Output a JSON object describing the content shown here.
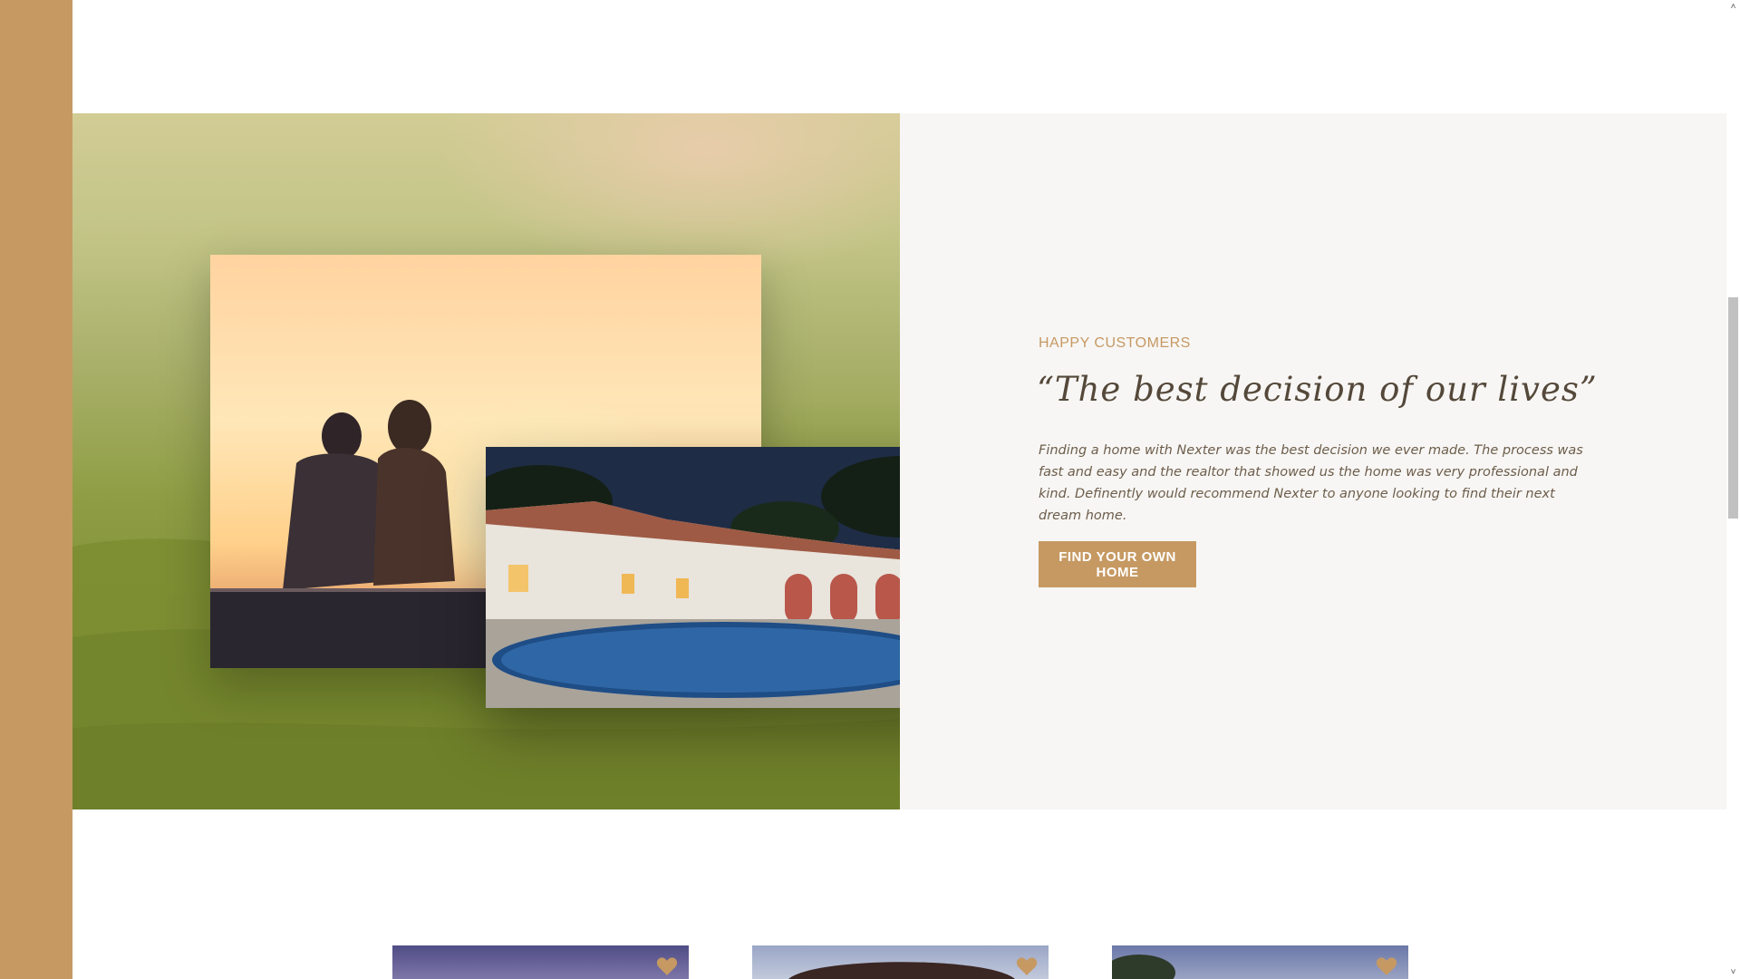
{
  "story": {
    "subheading": "HAPPY CUSTOMERS",
    "heading": "“The best decision of our lives”",
    "text": "Finding a home with Nexter was the best decision we ever made. The process was fast and easy and the realtor that showed us the home was very professional and kind. Definently would recommend Nexter to anyone looking to find their next dream home.",
    "button_label": "FIND YOUR OWN HOME"
  },
  "colors": {
    "primary": "#c69963",
    "heading": "#54483a",
    "text": "#6d5d4b",
    "background_light": "#f7f6f4"
  },
  "homes": {
    "icons": [
      "heart-icon",
      "heart-icon",
      "heart-icon"
    ]
  },
  "scrollbar": {
    "up_icon": "chevron-up-icon",
    "down_icon": "chevron-down-icon"
  }
}
